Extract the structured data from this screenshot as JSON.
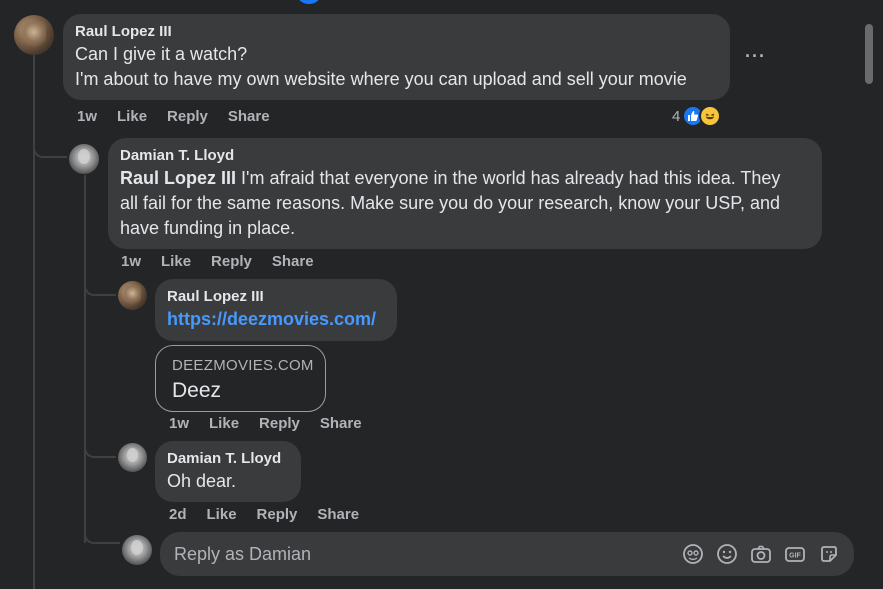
{
  "comments": [
    {
      "author": "Raul Lopez III",
      "lines": [
        "Can I give it a watch?",
        "I'm about to have my own website where you can upload and sell your movie"
      ],
      "time": "1w",
      "actions": [
        "Like",
        "Reply",
        "Share"
      ],
      "more": "···",
      "reaction_count": "4"
    },
    {
      "author": "Damian T. Lloyd",
      "mention": "Raul Lopez III",
      "line1_rest": " I'm afraid that everyone in the world has already had this idea. They",
      "line2": "all fail for the same reasons. Make sure you do your research, know your USP, and",
      "line3": "have funding in place.",
      "time": "1w",
      "actions": [
        "Like",
        "Reply",
        "Share"
      ]
    },
    {
      "author": "Raul Lopez III",
      "link": "https://deezmovies.com/",
      "preview_domain": "DEEZMOVIES.COM",
      "preview_title": "Deez",
      "time": "1w",
      "actions": [
        "Like",
        "Reply",
        "Share"
      ]
    },
    {
      "author": "Damian T. Lloyd",
      "text": "Oh dear.",
      "time": "2d",
      "actions": [
        "Like",
        "Reply",
        "Share"
      ]
    }
  ],
  "reply": {
    "placeholder": "Reply as Damian",
    "tools": [
      "avatar-sticker-icon",
      "emoji-icon",
      "camera-icon",
      "gif-icon",
      "sticker-icon"
    ],
    "gif_label": "GIF"
  },
  "colors": {
    "background": "#242526",
    "bubble": "#3a3b3c",
    "link": "#4599ff",
    "like": "#1877f2"
  }
}
